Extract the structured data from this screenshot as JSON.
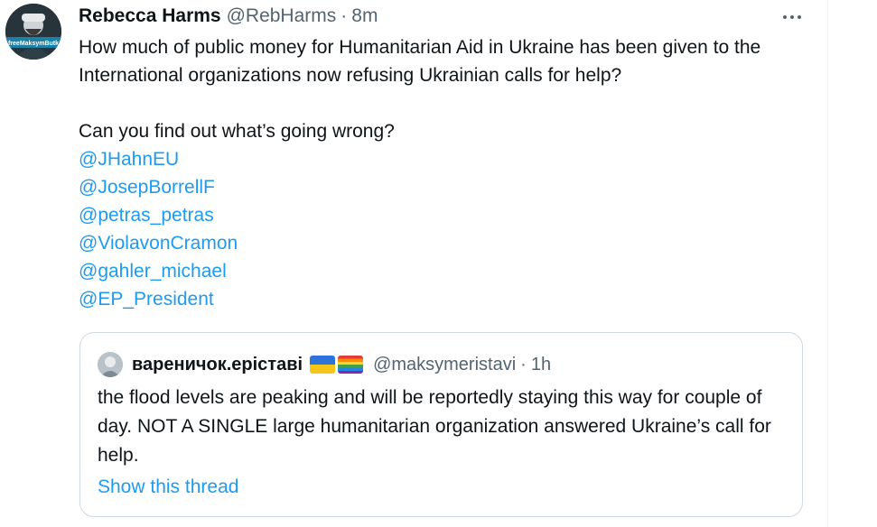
{
  "tweet": {
    "author": {
      "display_name": "Rebecca Harms",
      "handle": "@RebHarms",
      "avatar_text": "freeMaksymButk"
    },
    "separator": "·",
    "time": "8m",
    "text_line_1": "How much of public money for Humanitarian Aid in Ukraine has been given to the International organizations now refusing Ukrainian calls for help?",
    "text_line_2": "Can you find out what’s going wrong?",
    "mentions": [
      "@JHahnEU",
      "@JosepBorrellF",
      "@petras_petras",
      "@ViolavonCramon",
      "@gahler_michael",
      "@EP_President"
    ]
  },
  "quote": {
    "author": {
      "display_name": "вареничок.еріставі",
      "handle": "@maksymeristavi"
    },
    "separator": "·",
    "time": "1h",
    "text": "the flood levels are peaking and will be reportedly staying this way for couple of day. NOT A SINGLE large humanitarian organization answered Ukraine’s call for help.",
    "show_thread_label": "Show this thread"
  },
  "colors": {
    "link": "#1d9bf0",
    "secondary_text": "#536471",
    "primary_text": "#0f1419",
    "border": "#cfd9de"
  },
  "icons": {
    "more": "more-horizontal-icon",
    "flag_1": "ukraine-flag-emoji",
    "flag_2": "rainbow-flag-emoji"
  }
}
